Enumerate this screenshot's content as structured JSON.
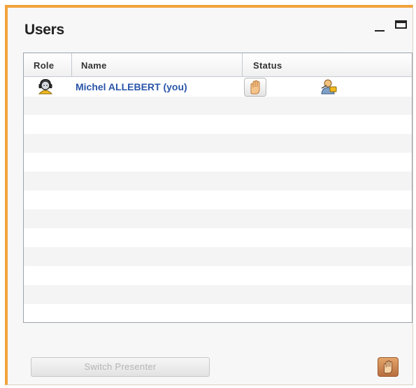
{
  "window": {
    "title": "Users"
  },
  "grid": {
    "columns": [
      "Role",
      "Name",
      "Status"
    ],
    "rows": [
      {
        "role_icon": "moderator-icon",
        "name": "Michel ALLEBERT (you)",
        "status_icons": [
          "raise-hand-icon",
          "presenter-icon"
        ]
      }
    ]
  },
  "footer": {
    "switch_presenter_label": "Switch Presenter",
    "switch_presenter_enabled": false,
    "hand_icon": "raise-hand-icon"
  },
  "colors": {
    "accent_border": "#f2a33c",
    "user_name": "#2a55a8"
  }
}
